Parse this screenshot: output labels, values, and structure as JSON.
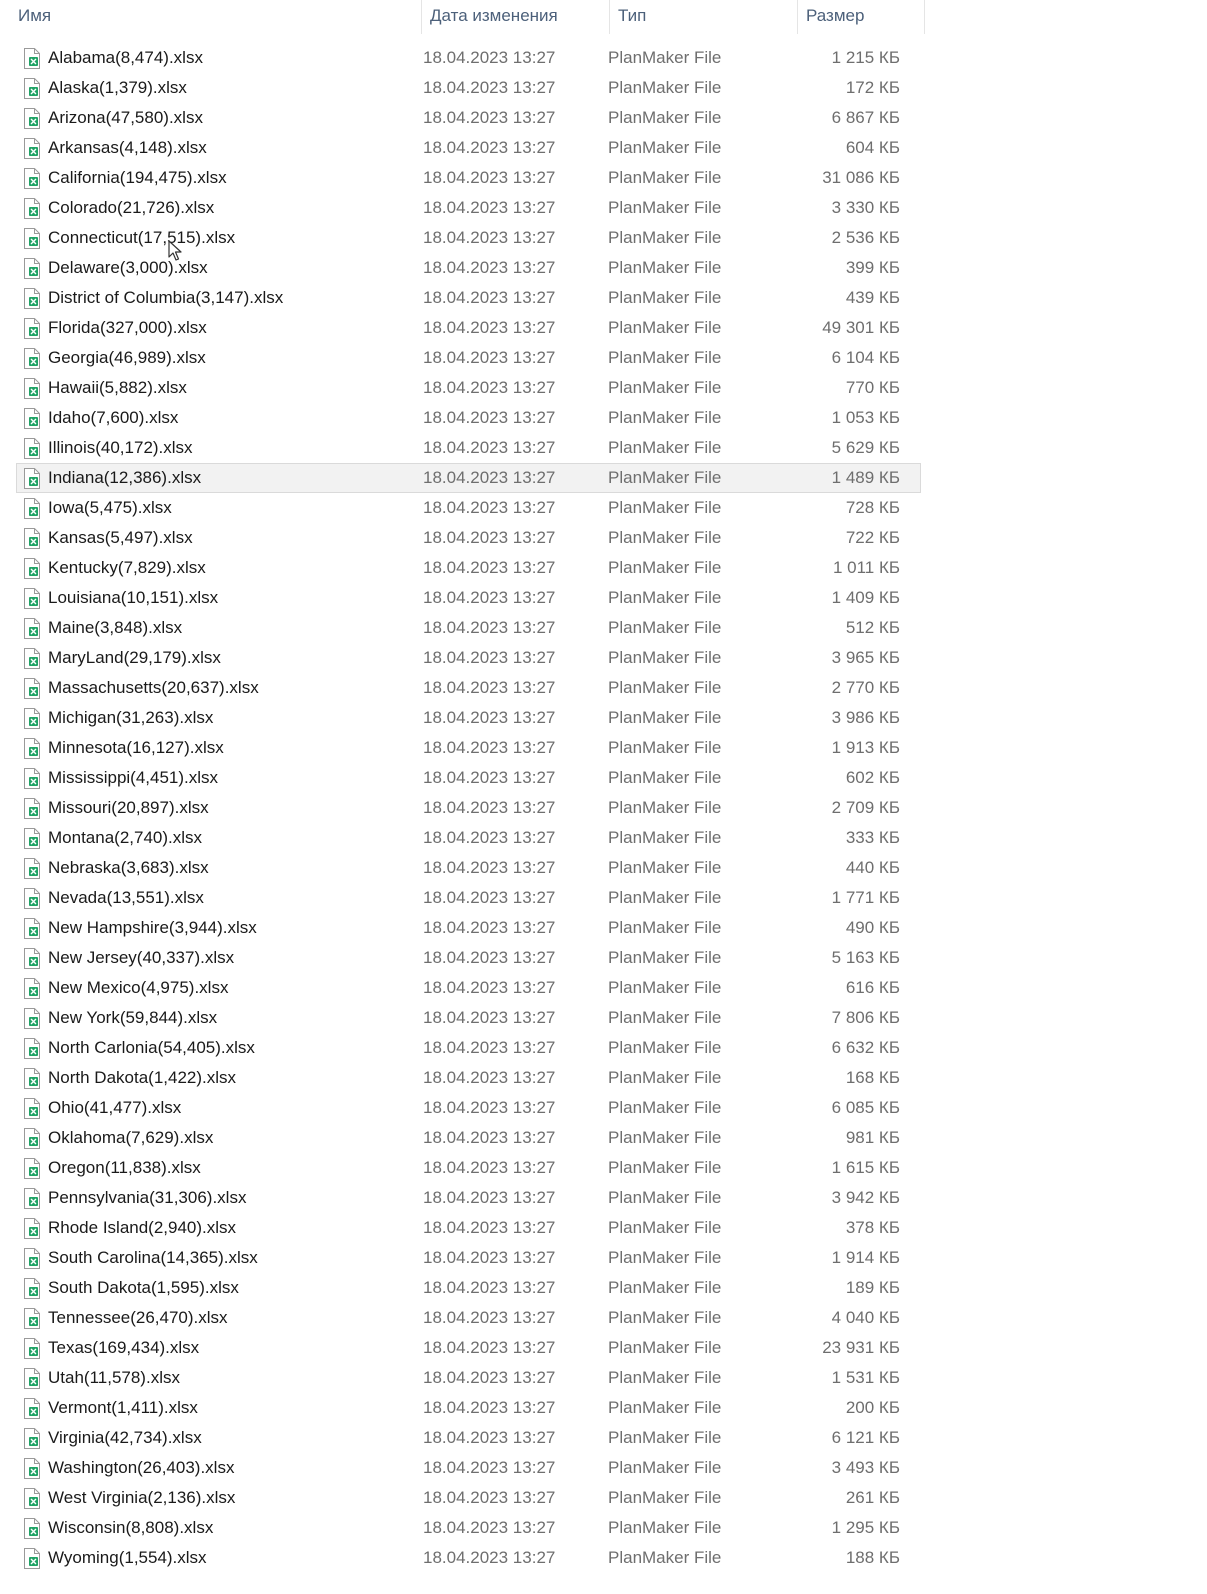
{
  "columns": {
    "name": "Имя",
    "date": "Дата изменения",
    "type": "Тип",
    "size": "Размер"
  },
  "icon": "xlsx-file-icon",
  "accent_color": "#21a366",
  "hovered_row": 14,
  "files": [
    {
      "name": "Alabama(8,474).xlsx",
      "date": "18.04.2023 13:27",
      "type": "PlanMaker File",
      "size": "1 215 КБ"
    },
    {
      "name": "Alaska(1,379).xlsx",
      "date": "18.04.2023 13:27",
      "type": "PlanMaker File",
      "size": "172 КБ"
    },
    {
      "name": "Arizona(47,580).xlsx",
      "date": "18.04.2023 13:27",
      "type": "PlanMaker File",
      "size": "6 867 КБ"
    },
    {
      "name": "Arkansas(4,148).xlsx",
      "date": "18.04.2023 13:27",
      "type": "PlanMaker File",
      "size": "604 КБ"
    },
    {
      "name": "California(194,475).xlsx",
      "date": "18.04.2023 13:27",
      "type": "PlanMaker File",
      "size": "31 086 КБ"
    },
    {
      "name": "Colorado(21,726).xlsx",
      "date": "18.04.2023 13:27",
      "type": "PlanMaker File",
      "size": "3 330 КБ"
    },
    {
      "name": "Connecticut(17,515).xlsx",
      "date": "18.04.2023 13:27",
      "type": "PlanMaker File",
      "size": "2 536 КБ"
    },
    {
      "name": "Delaware(3,000).xlsx",
      "date": "18.04.2023 13:27",
      "type": "PlanMaker File",
      "size": "399 КБ"
    },
    {
      "name": "District of Columbia(3,147).xlsx",
      "date": "18.04.2023 13:27",
      "type": "PlanMaker File",
      "size": "439 КБ"
    },
    {
      "name": "Florida(327,000).xlsx",
      "date": "18.04.2023 13:27",
      "type": "PlanMaker File",
      "size": "49 301 КБ"
    },
    {
      "name": "Georgia(46,989).xlsx",
      "date": "18.04.2023 13:27",
      "type": "PlanMaker File",
      "size": "6 104 КБ"
    },
    {
      "name": "Hawaii(5,882).xlsx",
      "date": "18.04.2023 13:27",
      "type": "PlanMaker File",
      "size": "770 КБ"
    },
    {
      "name": "Idaho(7,600).xlsx",
      "date": "18.04.2023 13:27",
      "type": "PlanMaker File",
      "size": "1 053 КБ"
    },
    {
      "name": "Illinois(40,172).xlsx",
      "date": "18.04.2023 13:27",
      "type": "PlanMaker File",
      "size": "5 629 КБ"
    },
    {
      "name": "Indiana(12,386).xlsx",
      "date": "18.04.2023 13:27",
      "type": "PlanMaker File",
      "size": "1 489 КБ"
    },
    {
      "name": "Iowa(5,475).xlsx",
      "date": "18.04.2023 13:27",
      "type": "PlanMaker File",
      "size": "728 КБ"
    },
    {
      "name": "Kansas(5,497).xlsx",
      "date": "18.04.2023 13:27",
      "type": "PlanMaker File",
      "size": "722 КБ"
    },
    {
      "name": "Kentucky(7,829).xlsx",
      "date": "18.04.2023 13:27",
      "type": "PlanMaker File",
      "size": "1 011 КБ"
    },
    {
      "name": "Louisiana(10,151).xlsx",
      "date": "18.04.2023 13:27",
      "type": "PlanMaker File",
      "size": "1 409 КБ"
    },
    {
      "name": "Maine(3,848).xlsx",
      "date": "18.04.2023 13:27",
      "type": "PlanMaker File",
      "size": "512 КБ"
    },
    {
      "name": "MaryLand(29,179).xlsx",
      "date": "18.04.2023 13:27",
      "type": "PlanMaker File",
      "size": "3 965 КБ"
    },
    {
      "name": "Massachusetts(20,637).xlsx",
      "date": "18.04.2023 13:27",
      "type": "PlanMaker File",
      "size": "2 770 КБ"
    },
    {
      "name": "Michigan(31,263).xlsx",
      "date": "18.04.2023 13:27",
      "type": "PlanMaker File",
      "size": "3 986 КБ"
    },
    {
      "name": "Minnesota(16,127).xlsx",
      "date": "18.04.2023 13:27",
      "type": "PlanMaker File",
      "size": "1 913 КБ"
    },
    {
      "name": "Mississippi(4,451).xlsx",
      "date": "18.04.2023 13:27",
      "type": "PlanMaker File",
      "size": "602 КБ"
    },
    {
      "name": "Missouri(20,897).xlsx",
      "date": "18.04.2023 13:27",
      "type": "PlanMaker File",
      "size": "2 709 КБ"
    },
    {
      "name": "Montana(2,740).xlsx",
      "date": "18.04.2023 13:27",
      "type": "PlanMaker File",
      "size": "333 КБ"
    },
    {
      "name": "Nebraska(3,683).xlsx",
      "date": "18.04.2023 13:27",
      "type": "PlanMaker File",
      "size": "440 КБ"
    },
    {
      "name": "Nevada(13,551).xlsx",
      "date": "18.04.2023 13:27",
      "type": "PlanMaker File",
      "size": "1 771 КБ"
    },
    {
      "name": "New Hampshire(3,944).xlsx",
      "date": "18.04.2023 13:27",
      "type": "PlanMaker File",
      "size": "490 КБ"
    },
    {
      "name": "New Jersey(40,337).xlsx",
      "date": "18.04.2023 13:27",
      "type": "PlanMaker File",
      "size": "5 163 КБ"
    },
    {
      "name": "New Mexico(4,975).xlsx",
      "date": "18.04.2023 13:27",
      "type": "PlanMaker File",
      "size": "616 КБ"
    },
    {
      "name": "New York(59,844).xlsx",
      "date": "18.04.2023 13:27",
      "type": "PlanMaker File",
      "size": "7 806 КБ"
    },
    {
      "name": "North Carlonia(54,405).xlsx",
      "date": "18.04.2023 13:27",
      "type": "PlanMaker File",
      "size": "6 632 КБ"
    },
    {
      "name": "North Dakota(1,422).xlsx",
      "date": "18.04.2023 13:27",
      "type": "PlanMaker File",
      "size": "168 КБ"
    },
    {
      "name": "Ohio(41,477).xlsx",
      "date": "18.04.2023 13:27",
      "type": "PlanMaker File",
      "size": "6 085 КБ"
    },
    {
      "name": "Oklahoma(7,629).xlsx",
      "date": "18.04.2023 13:27",
      "type": "PlanMaker File",
      "size": "981 КБ"
    },
    {
      "name": "Oregon(11,838).xlsx",
      "date": "18.04.2023 13:27",
      "type": "PlanMaker File",
      "size": "1 615 КБ"
    },
    {
      "name": "Pennsylvania(31,306).xlsx",
      "date": "18.04.2023 13:27",
      "type": "PlanMaker File",
      "size": "3 942 КБ"
    },
    {
      "name": "Rhode Island(2,940).xlsx",
      "date": "18.04.2023 13:27",
      "type": "PlanMaker File",
      "size": "378 КБ"
    },
    {
      "name": "South Carolina(14,365).xlsx",
      "date": "18.04.2023 13:27",
      "type": "PlanMaker File",
      "size": "1 914 КБ"
    },
    {
      "name": "South Dakota(1,595).xlsx",
      "date": "18.04.2023 13:27",
      "type": "PlanMaker File",
      "size": "189 КБ"
    },
    {
      "name": "Tennessee(26,470).xlsx",
      "date": "18.04.2023 13:27",
      "type": "PlanMaker File",
      "size": "4 040 КБ"
    },
    {
      "name": "Texas(169,434).xlsx",
      "date": "18.04.2023 13:27",
      "type": "PlanMaker File",
      "size": "23 931 КБ"
    },
    {
      "name": "Utah(11,578).xlsx",
      "date": "18.04.2023 13:27",
      "type": "PlanMaker File",
      "size": "1 531 КБ"
    },
    {
      "name": "Vermont(1,411).xlsx",
      "date": "18.04.2023 13:27",
      "type": "PlanMaker File",
      "size": "200 КБ"
    },
    {
      "name": "Virginia(42,734).xlsx",
      "date": "18.04.2023 13:27",
      "type": "PlanMaker File",
      "size": "6 121 КБ"
    },
    {
      "name": "Washington(26,403).xlsx",
      "date": "18.04.2023 13:27",
      "type": "PlanMaker File",
      "size": "3 493 КБ"
    },
    {
      "name": "West Virginia(2,136).xlsx",
      "date": "18.04.2023 13:27",
      "type": "PlanMaker File",
      "size": "261 КБ"
    },
    {
      "name": "Wisconsin(8,808).xlsx",
      "date": "18.04.2023 13:27",
      "type": "PlanMaker File",
      "size": "1 295 КБ"
    },
    {
      "name": "Wyoming(1,554).xlsx",
      "date": "18.04.2023 13:27",
      "type": "PlanMaker File",
      "size": "188 КБ"
    }
  ]
}
